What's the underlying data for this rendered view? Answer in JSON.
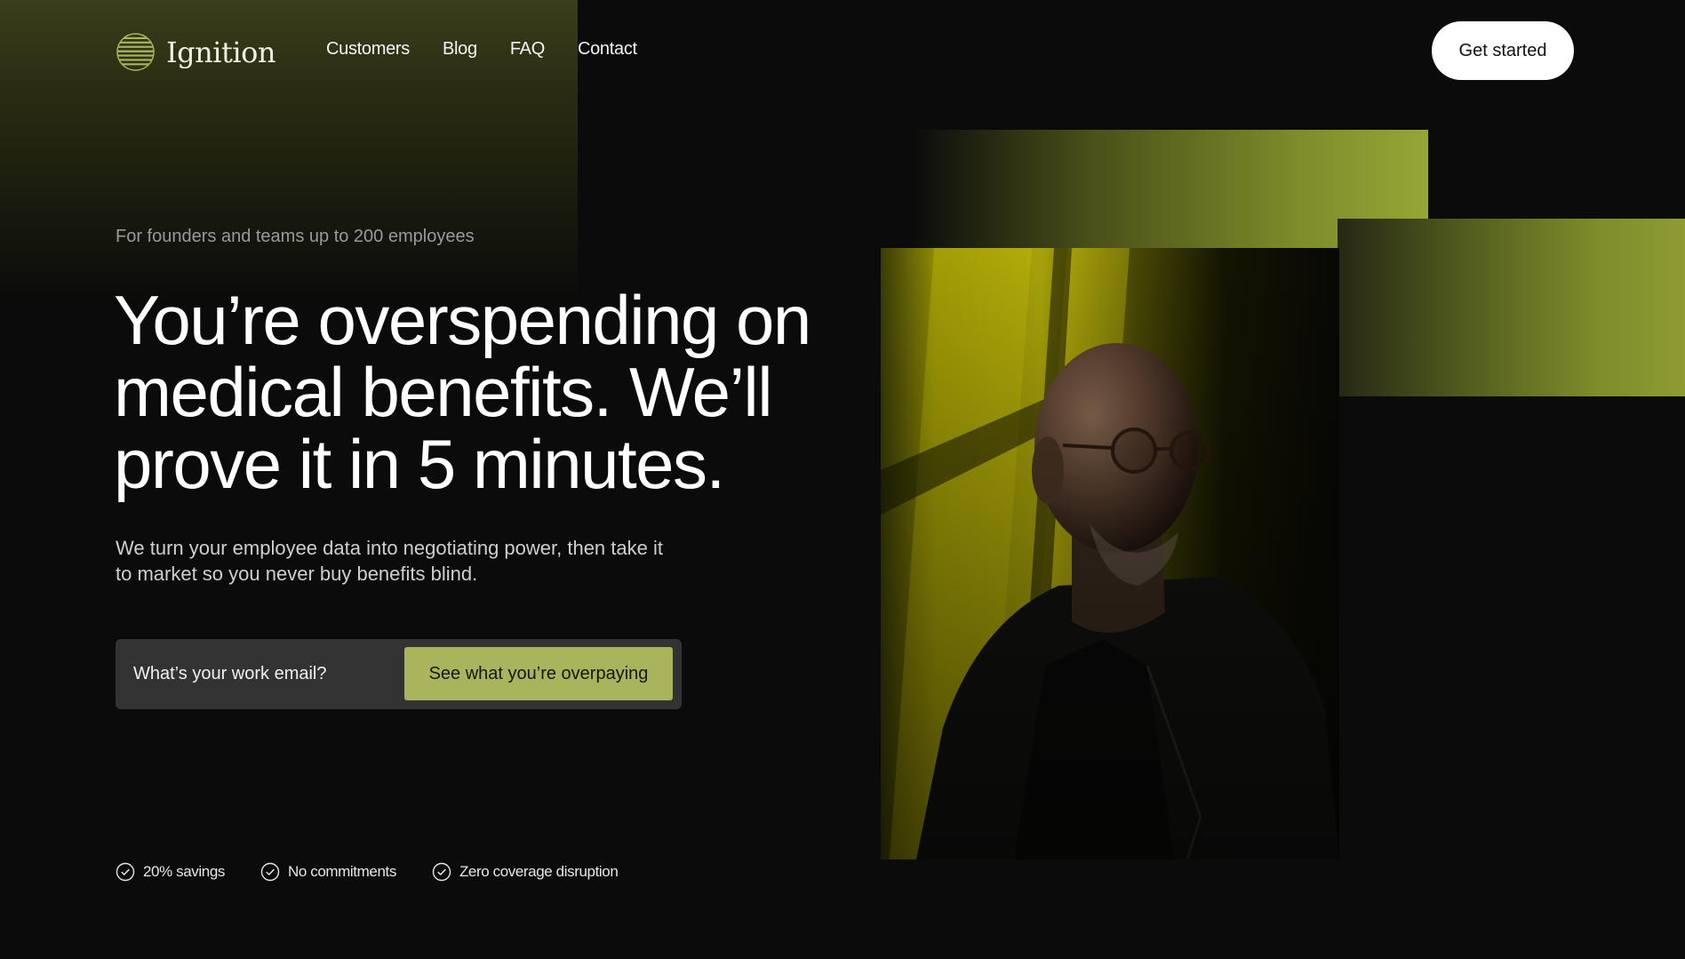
{
  "brand": {
    "name": "Ignition",
    "logo_icon": "striped-globe-icon"
  },
  "nav": {
    "items": [
      "Customers",
      "Blog",
      "FAQ",
      "Contact"
    ]
  },
  "header": {
    "cta_label": "Get started"
  },
  "hero": {
    "eyebrow": "For founders and teams up to 200 employees",
    "headline": "You’re overspending on medical benefits. We’ll prove it in 5 minutes.",
    "subheadline": "We turn your employee data into negotiating power, then take it to market so you never buy benefits blind."
  },
  "email_form": {
    "placeholder": "What’s your work email?",
    "value": "",
    "submit_label": "See what you’re overpaying"
  },
  "features": [
    {
      "label": "20% savings",
      "icon": "check-circle-icon"
    },
    {
      "label": "No commitments",
      "icon": "check-circle-icon"
    },
    {
      "label": "Zero coverage disruption",
      "icon": "check-circle-icon"
    }
  ],
  "colors": {
    "background": "#0b0b0b",
    "accent": "#a9b45c",
    "band": "#97a636",
    "input_bg": "#333333"
  }
}
